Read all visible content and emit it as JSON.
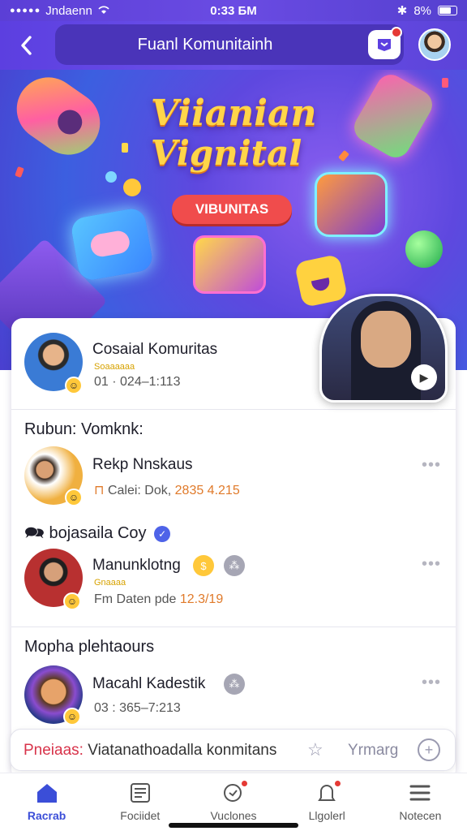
{
  "status_bar": {
    "carrier": "Jndaenn",
    "time": "0:33 БM",
    "battery": "8%"
  },
  "header": {
    "title": "Fuanl Komunitainh",
    "back_icon": "chevron-left-icon",
    "notification_icon": "inbox-icon"
  },
  "banner": {
    "title_line1": "Viianian",
    "title_line2": "Vignital",
    "tag": "VIBUNITAS"
  },
  "featured": {
    "name": "Cosaial Komuritas",
    "subtitle": "Soaaaaaa",
    "meta": "01 · 024–1:113"
  },
  "sections": [
    {
      "title": "Rubun: Vomknk:",
      "items": [
        {
          "name": "Rekp Nnskaus",
          "meta_prefix": "Calei: Dok,",
          "meta_value": "2835 4.215"
        }
      ]
    },
    {
      "title": "bojasaila Coy",
      "title_icon": "🗪",
      "items": [
        {
          "name": "Manunklotng",
          "subtitle": "Gnaaaa",
          "meta_prefix": "Fm Daten pde",
          "meta_value": "12.3/19"
        }
      ]
    },
    {
      "title": "Mopha plehtaours",
      "items": [
        {
          "name": "Macahl Kadestik",
          "meta": "03 : 365–7:213"
        }
      ]
    }
  ],
  "search": {
    "prefix": "Pneiaas:",
    "text": "Viatanathoadalla konmitans",
    "right_label": "Yrmarg"
  },
  "nav": {
    "items": [
      {
        "label": "Racrab",
        "active": true
      },
      {
        "label": "Fociidet",
        "active": false
      },
      {
        "label": "Vuclones",
        "active": false
      },
      {
        "label": "Llgolerl",
        "active": false
      },
      {
        "label": "Notecen",
        "active": false
      }
    ]
  },
  "colors": {
    "header": "#5c3fe0",
    "accent": "#3b4ed8",
    "badge_red": "#e53935",
    "meta_orange": "#e07a2a"
  }
}
